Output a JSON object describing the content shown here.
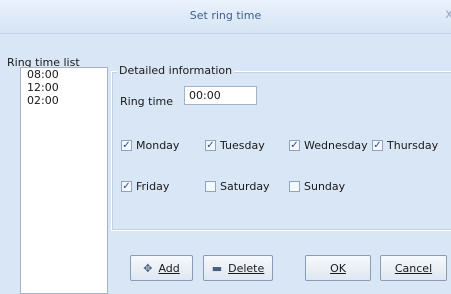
{
  "window": {
    "title": "Set ring time",
    "close_glyph": "x"
  },
  "ring_list": {
    "label": "Ring time list",
    "items": [
      "08:00",
      "12:00",
      "02:00"
    ]
  },
  "details": {
    "legend": "Detailed information",
    "ring_time_label": "Ring time",
    "ring_time_value": "00:00",
    "days": [
      {
        "label": "Monday",
        "checked": true
      },
      {
        "label": "Tuesday",
        "checked": true
      },
      {
        "label": "Wednesday",
        "checked": true
      },
      {
        "label": "Thursday",
        "checked": true
      },
      {
        "label": "Friday",
        "checked": true
      },
      {
        "label": "Saturday",
        "checked": false
      },
      {
        "label": "Sunday",
        "checked": false
      }
    ]
  },
  "buttons": {
    "add": {
      "label": "Add",
      "icon": "plus-icon"
    },
    "delete": {
      "label": "Delete",
      "icon": "minus-icon"
    },
    "ok": {
      "label": "OK"
    },
    "cancel": {
      "label": "Cancel"
    }
  },
  "colors": {
    "window_bg": "#d9e6f6",
    "title_text": "#3f5f8c",
    "check_mark": "#2a4f86"
  }
}
